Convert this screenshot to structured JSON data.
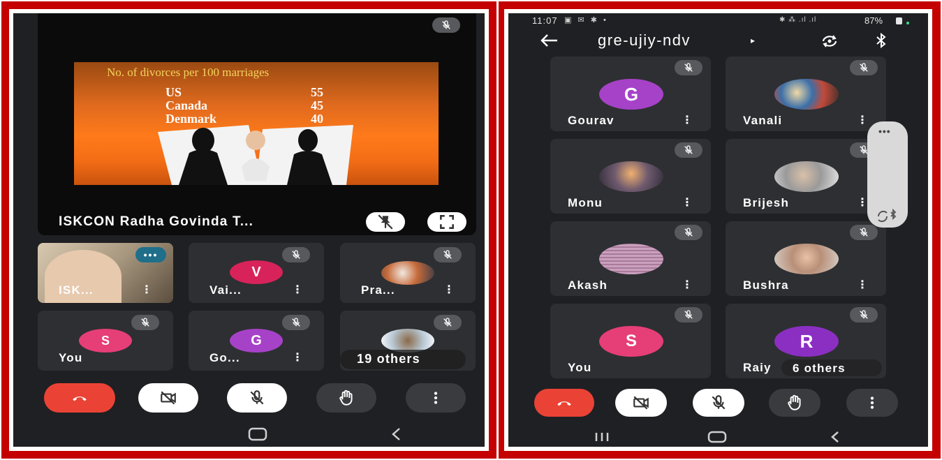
{
  "left": {
    "presenter_name": "ISKCON Radha Govinda T...",
    "slide": {
      "title": "No. of divorces per 100 marriages",
      "rows": [
        {
          "country": "US",
          "value": "55"
        },
        {
          "country": "Canada",
          "value": "45"
        },
        {
          "country": "Denmark",
          "value": "40"
        }
      ]
    },
    "participants": [
      {
        "name": "ISK...",
        "initial": "",
        "color": ""
      },
      {
        "name": "Vai...",
        "initial": "V",
        "color": "#d8235a"
      },
      {
        "name": "Pra...",
        "initial": "",
        "color": ""
      },
      {
        "name": "You",
        "initial": "S",
        "color": "#e63e77"
      },
      {
        "name": "Go...",
        "initial": "G",
        "color": "#a642c8"
      },
      {
        "name": "19 others",
        "initial": "",
        "color": ""
      }
    ]
  },
  "right": {
    "status_bar": {
      "time": "11:07",
      "battery": "87%"
    },
    "meeting_code": "gre-ujiy-ndv",
    "participants": [
      {
        "name": "Gourav",
        "initial": "G",
        "color": "#a642c8"
      },
      {
        "name": "Vanali",
        "initial": "",
        "color": ""
      },
      {
        "name": "Monu",
        "initial": "",
        "color": ""
      },
      {
        "name": "Brijesh",
        "initial": "",
        "color": ""
      },
      {
        "name": "Akash",
        "initial": "",
        "color": ""
      },
      {
        "name": "Bushra",
        "initial": "",
        "color": ""
      },
      {
        "name": "You",
        "initial": "S",
        "color": "#e63e77"
      },
      {
        "name": "Raiy",
        "initial": "R",
        "color": "#8b2fc2"
      }
    ],
    "others_label": "6 others"
  },
  "colors": {
    "frame": "#c40000",
    "tile_bg": "#2e2f32",
    "end_call": "#ea4335"
  }
}
